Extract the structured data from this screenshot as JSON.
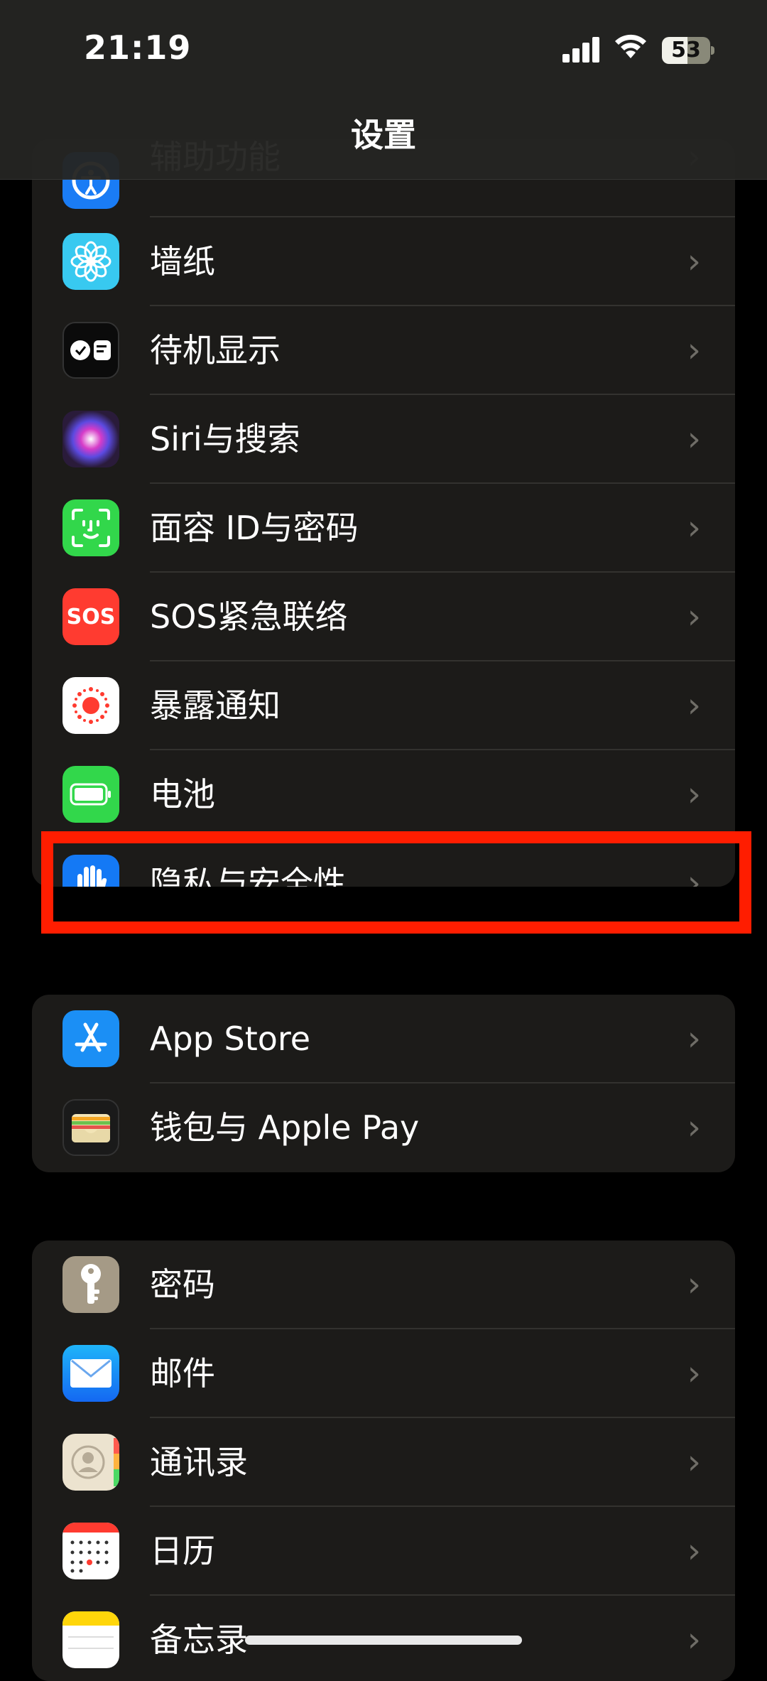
{
  "status_bar": {
    "time": "21:19",
    "battery_level": "53"
  },
  "header": {
    "title": "设置"
  },
  "group1": {
    "items": [
      {
        "label": "辅助功能",
        "icon": "accessibility-icon",
        "color": "#1a7cf5"
      },
      {
        "label": "墙纸",
        "icon": "flower-wallpaper-icon",
        "color": "#38c9f0"
      },
      {
        "label": "待机显示",
        "icon": "standby-icon",
        "color": "#0b0b0b"
      },
      {
        "label": "Siri与搜索",
        "icon": "siri-icon",
        "color": "#2a1b3a"
      },
      {
        "label": "面容 ID与密码",
        "icon": "face-id-icon",
        "color": "#32d74b"
      },
      {
        "label": "SOS紧急联络",
        "icon": "sos-icon",
        "color": "#ff3b30"
      },
      {
        "label": "暴露通知",
        "icon": "exposure-notification-icon",
        "color": "#ffffff"
      },
      {
        "label": "电池",
        "icon": "battery-icon",
        "color": "#32d74b"
      },
      {
        "label": "隐私与安全性",
        "icon": "hand-privacy-icon",
        "color": "#1479f5"
      }
    ]
  },
  "group2": {
    "items": [
      {
        "label": "App Store",
        "icon": "app-store-icon",
        "color": "#1b8ff5"
      },
      {
        "label": "钱包与 Apple Pay",
        "icon": "wallet-icon",
        "color": "#1a1a1a"
      }
    ]
  },
  "group3": {
    "items": [
      {
        "label": "密码",
        "icon": "key-icon",
        "color": "#a59a86"
      },
      {
        "label": "邮件",
        "icon": "mail-icon",
        "color": "#1d8cf8"
      },
      {
        "label": "通讯录",
        "icon": "contacts-icon",
        "color": "#ece3cf"
      },
      {
        "label": "日历",
        "icon": "calendar-icon",
        "color": "#ffffff"
      },
      {
        "label": "备忘录",
        "icon": "notes-icon",
        "color": "#ffffff"
      }
    ]
  },
  "highlight_color": "#ff1d00"
}
